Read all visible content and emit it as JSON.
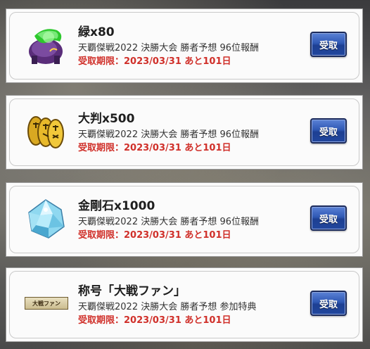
{
  "colors": {
    "deadline": "#d0302a",
    "button": "#2f58b4"
  },
  "rewards": [
    {
      "icon": "green-horse-figure-icon",
      "name": "緑x80",
      "source": "天覇傑戦2022 決勝大会 勝者予想 96位報酬",
      "deadline": "受取期限：2023/03/31 あと101日",
      "button": "受取"
    },
    {
      "icon": "gold-coins-icon",
      "name": "大判x500",
      "source": "天覇傑戦2022 決勝大会 勝者予想 96位報酬",
      "deadline": "受取期限：2023/03/31 あと101日",
      "button": "受取"
    },
    {
      "icon": "diamond-crystal-icon",
      "name": "金剛石x1000",
      "source": "天覇傑戦2022 決勝大会 勝者予想 96位報酬",
      "deadline": "受取期限：2023/03/31 あと101日",
      "button": "受取"
    },
    {
      "icon": "title-plate-icon",
      "plate_text": "大戦ファン",
      "name": "称号「大戦ファン」",
      "source": "天覇傑戦2022 決勝大会 勝者予想 参加特典",
      "deadline": "受取期限：2023/03/31 あと101日",
      "button": "受取"
    }
  ]
}
